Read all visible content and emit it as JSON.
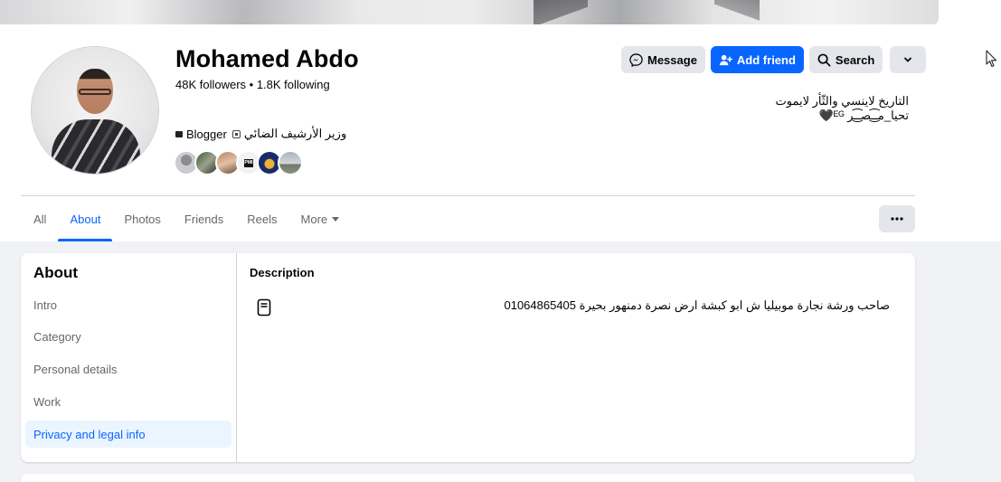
{
  "profile": {
    "name": "Mohamed Abdo",
    "stats": "48K followers • 1.8K following",
    "bio_line1": "التاريخ لاينسي والثّأر لايموت",
    "bio_line2": "تحيا_مـ͜͡ـصـ͜͡ـر ᴱᴳ🖤",
    "intro_category": "Blogger",
    "intro_role": "وزير الأرشيف الضائي"
  },
  "actions": {
    "message": "Message",
    "add_friend": "Add friend",
    "search": "Search"
  },
  "tabs": [
    {
      "label": "All"
    },
    {
      "label": "About"
    },
    {
      "label": "Photos"
    },
    {
      "label": "Friends"
    },
    {
      "label": "Reels"
    },
    {
      "label": "More"
    }
  ],
  "about": {
    "title": "About",
    "items": [
      {
        "label": "Intro"
      },
      {
        "label": "Category"
      },
      {
        "label": "Personal details"
      },
      {
        "label": "Work"
      },
      {
        "label": "Privacy and legal info"
      }
    ],
    "section_title": "Description",
    "description": "صاحب ورشة نجارة موبيليا ش ابو كبشة ارض نصرة دمنهور بحيرة 01064865405"
  },
  "colors": {
    "accent": "#0866ff",
    "button_gray": "#e4e6eb",
    "page_bg": "#f0f2f5",
    "muted_text": "#65676b"
  },
  "icons": [
    "messenger-icon",
    "add-friend-icon",
    "search-icon",
    "chevron-down-icon",
    "more-dots-icon",
    "document-icon",
    "cursor-icon"
  ]
}
